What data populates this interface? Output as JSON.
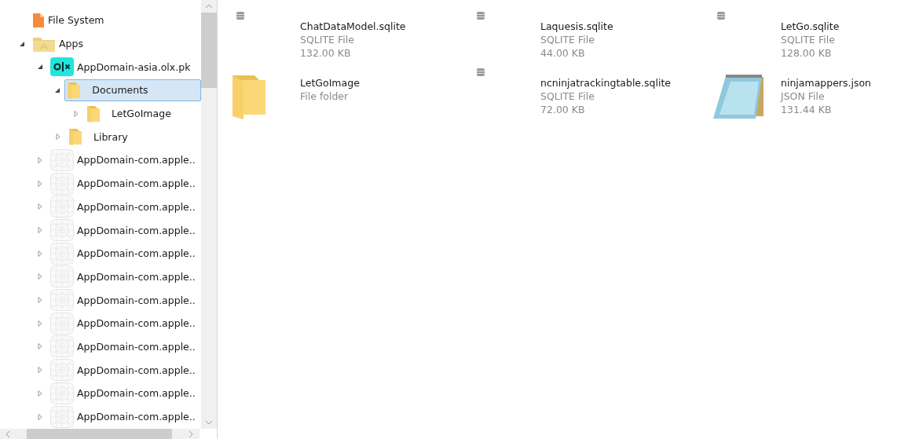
{
  "tree": [
    {
      "label": "File System",
      "kind": "file",
      "selected": false
    },
    {
      "label": "Apps",
      "kind": "apps",
      "expanded": true,
      "selected": false,
      "children": [
        {
          "label": "AppDomain-asia.olx.pk",
          "kind": "logo",
          "expanded": true,
          "selected": false,
          "children": [
            {
              "label": "Documents",
              "kind": "folder",
              "expanded": true,
              "selected": true,
              "children": [
                {
                  "label": "LetGoImage",
                  "kind": "folder",
                  "expanded": false,
                  "selected": false
                }
              ]
            },
            {
              "label": "Library",
              "kind": "folder",
              "expanded": false,
              "selected": false
            }
          ]
        },
        {
          "label": "AppDomain-com.apple..",
          "kind": "app",
          "expanded": false,
          "selected": false
        },
        {
          "label": "AppDomain-com.apple..",
          "kind": "app",
          "expanded": false,
          "selected": false
        },
        {
          "label": "AppDomain-com.apple..",
          "kind": "app",
          "expanded": false,
          "selected": false
        },
        {
          "label": "AppDomain-com.apple..",
          "kind": "app",
          "expanded": false,
          "selected": false
        },
        {
          "label": "AppDomain-com.apple..",
          "kind": "app",
          "expanded": false,
          "selected": false
        },
        {
          "label": "AppDomain-com.apple..",
          "kind": "app",
          "expanded": false,
          "selected": false
        },
        {
          "label": "AppDomain-com.apple..",
          "kind": "app",
          "expanded": false,
          "selected": false
        },
        {
          "label": "AppDomain-com.apple..",
          "kind": "app",
          "expanded": false,
          "selected": false
        },
        {
          "label": "AppDomain-com.apple..",
          "kind": "app",
          "expanded": false,
          "selected": false
        },
        {
          "label": "AppDomain-com.apple..",
          "kind": "app",
          "expanded": false,
          "selected": false
        },
        {
          "label": "AppDomain-com.apple..",
          "kind": "app",
          "expanded": false,
          "selected": false
        },
        {
          "label": "AppDomain-com.apple..",
          "kind": "app",
          "expanded": false,
          "selected": false
        }
      ]
    }
  ],
  "files": [
    {
      "kind": "sqlite",
      "name": "ChatDataModel.sqlite",
      "type": "SQLITE File",
      "size": "132.00 KB"
    },
    {
      "kind": "sqlite",
      "name": "Laquesis.sqlite",
      "type": "SQLITE File",
      "size": "44.00 KB"
    },
    {
      "kind": "sqlite",
      "name": "LetGo.sqlite",
      "type": "SQLITE File",
      "size": "128.00 KB"
    },
    {
      "kind": "folder",
      "name": "LetGoImage",
      "type": "File folder"
    },
    {
      "kind": "sqlite",
      "name": "ncninjatrackingtable.sqlite",
      "type": "SQLITE File",
      "size": "72.00 KB"
    },
    {
      "kind": "json",
      "name": "ninjamappers.json",
      "type": "JSON File",
      "size": "131.44 KB"
    }
  ]
}
